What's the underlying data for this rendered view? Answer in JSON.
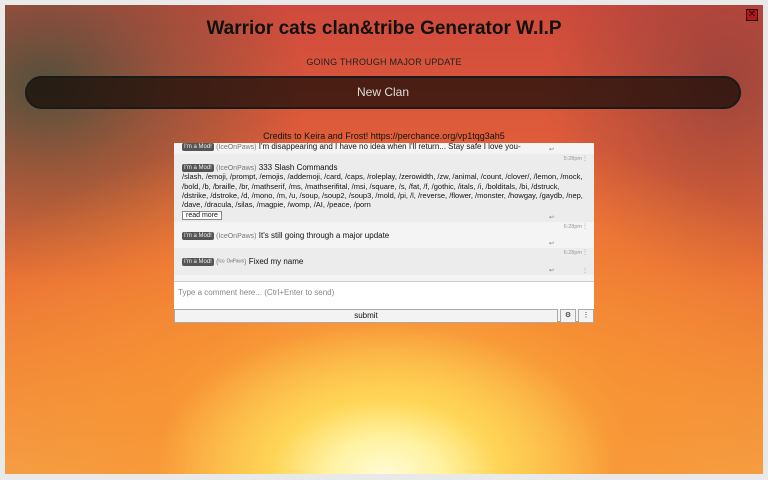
{
  "header": {
    "title": "Warrior cats clan&tribe Generator W.I.P",
    "subtitle": "GOING THROUGH MAJOR UPDATE",
    "generate_label": "New Clan",
    "credits": "Credits to Keira and Frost! https://perchance.org/vp1tqg3ah5",
    "close_icon": "close-icon",
    "close_color": "#b21a1a"
  },
  "chat": {
    "messages": [
      {
        "badge": "I'm a Mod!",
        "user": "(IceOnPaws)",
        "text": "I'm disappearing and I have no idea when I'll return... Stay safe I love you-",
        "time": "",
        "reply": "↩",
        "menu": "⋮"
      },
      {
        "badge": "I'm a Mod!",
        "user": "(IceOnPaws)",
        "text": "333 Slash Commands",
        "commands": "/slash, /emoji, /prompt, /emojis, /addemoji, /card, /caps, /roleplay, /zerowidth, /zw, /animal, /count, /clover/, /lemon, /mock, /bold, /b, /braille, /br, /mathserif, /ms, /mathserifital, /msi, /square, /s, /fat, /f, /gothic, /itals, /i, /bolditals, /bi, /dstruck, /dstrike, /dstroke, /d, /mono, /m, /u, /soup, /soup2, /soup3, /mold, /pi, /l, /reverse, /flower, /monster, /howgay, /gaydb, /nep, /dave, /dracula, /silas, /magpie, /womp, /AI, /peace, /porn",
        "read_more": "read more",
        "time": "5:28pm",
        "reply": "↩",
        "menu": "⋮"
      },
      {
        "badge": "I'm a Mod!",
        "user": "(IceOnPaws)",
        "text": "It's still going through a major update",
        "time": "6:28pm",
        "reply": "↩",
        "menu": "⋮"
      },
      {
        "badge": "I'm a Mod!",
        "user": "(ᴵᶜᵉ ᴼᶰᴾᵃʷˢ)",
        "text": "Fixed my name",
        "time": "6:28pm",
        "reply": "↩",
        "menu": "⋮"
      }
    ],
    "input_placeholder": "Type a comment here... (Ctrl+Enter to send)",
    "submit_label": "submit",
    "settings_icon": "⚙",
    "options_icon": "⋮"
  }
}
